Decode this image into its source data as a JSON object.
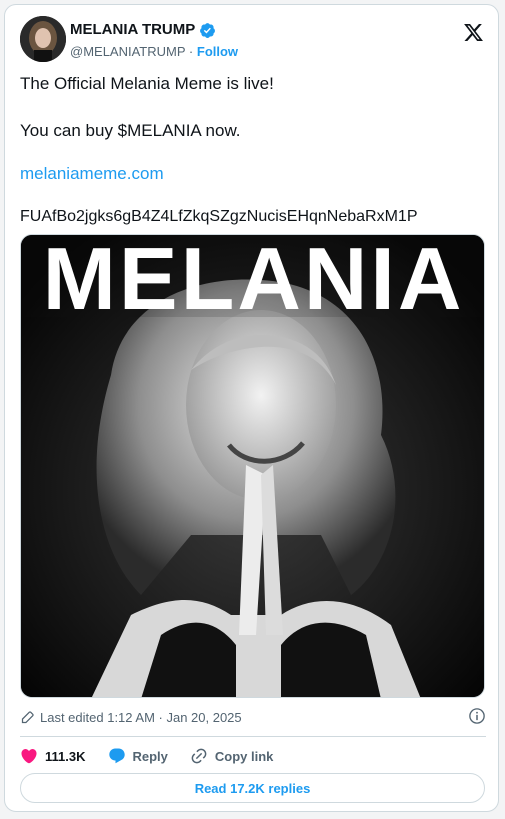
{
  "author": {
    "name": "MELANIA TRUMP",
    "handle": "@MELANIATRUMP",
    "separator": "·",
    "follow_label": "Follow"
  },
  "tweet": {
    "lines": [
      "The Official Melania Meme is live!",
      "You can buy $MELANIA now.",
      "melaniameme.com",
      "FUAfBo2jgks6gB4Z4LfZkqSZgzNucisEHqnNebaRxM1P"
    ]
  },
  "media": {
    "banner_text": "MELANIA"
  },
  "meta": {
    "edited_text": "Last edited 1:12 AM · Jan 20, 2025"
  },
  "actions": {
    "likes_count": "111.3K",
    "reply_label": "Reply",
    "copy_link_label": "Copy link"
  },
  "read_replies_label": "Read 17.2K replies",
  "colors": {
    "link_blue": "#1d9bf0",
    "like_pink": "#f91880",
    "verified_blue": "#1d9bf0",
    "text_gray": "#536471"
  },
  "icons": [
    "avatar",
    "verified-badge-icon",
    "x-logo-icon",
    "pencil-icon",
    "info-icon",
    "heart-icon",
    "reply-bubble-icon",
    "link-icon"
  ]
}
